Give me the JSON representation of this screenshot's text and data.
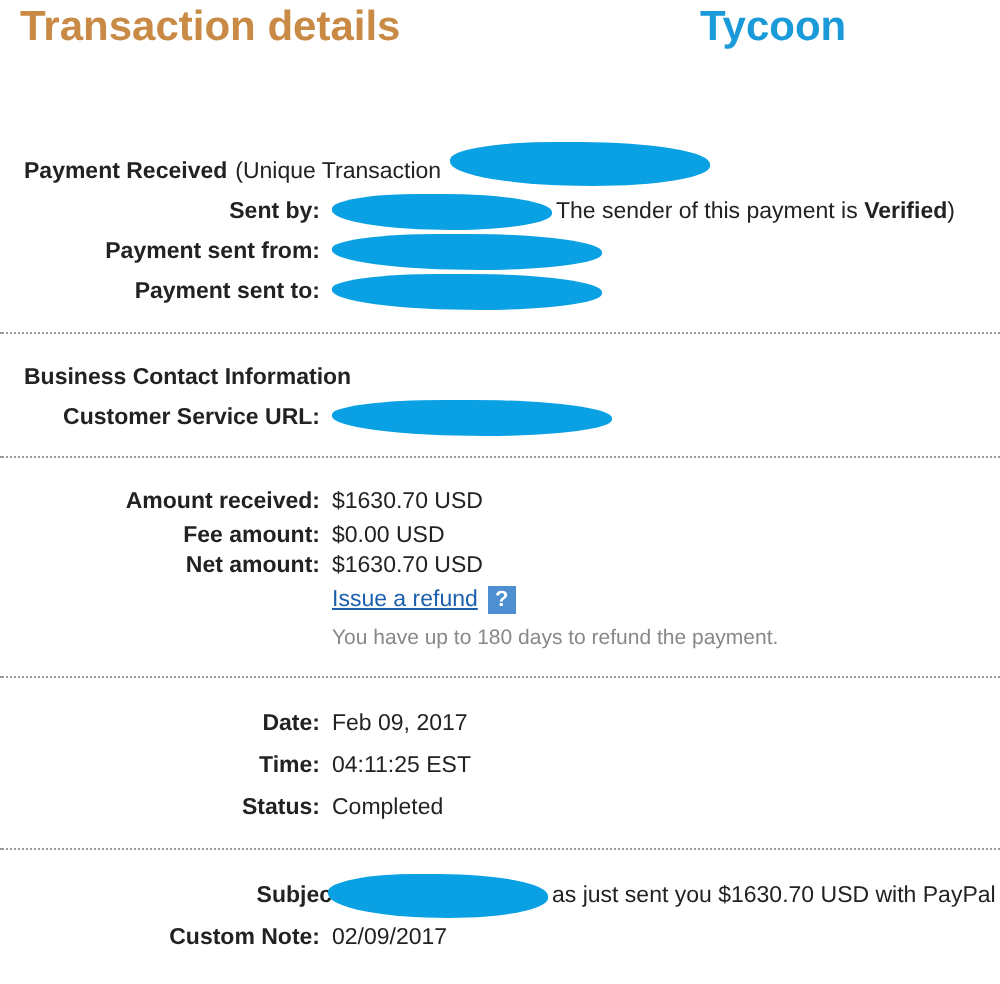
{
  "title": "Transaction details",
  "brand": "Tycoon",
  "payment": {
    "heading": "Payment Received",
    "heading_note": "(Unique Transaction",
    "rows": [
      {
        "label": "Sent by:",
        "after": "The sender of this payment is **Verified**)"
      },
      {
        "label": "Payment sent from:"
      },
      {
        "label": "Payment sent to:"
      }
    ]
  },
  "business": {
    "heading": "Business Contact Information",
    "rows": [
      {
        "label": "Customer Service URL:"
      }
    ]
  },
  "amounts": [
    {
      "label": "Amount received:",
      "value": "$1630.70 USD"
    },
    {
      "label": "Fee amount:",
      "value": "$0.00 USD"
    },
    {
      "label": "Net amount:",
      "value": "$1630.70 USD"
    }
  ],
  "refund": {
    "link": "Issue a refund",
    "help": "?",
    "note": "You have up to 180 days to refund the payment."
  },
  "details": [
    {
      "label": "Date:",
      "value": "Feb 09, 2017"
    },
    {
      "label": "Time:",
      "value": "04:11:25 EST"
    },
    {
      "label": "Status:",
      "value": "Completed"
    }
  ],
  "message": {
    "subject_label": "Subjec",
    "subject_tail": "as just sent you $1630.70 USD with PayPal",
    "note_label": "Custom Note:",
    "note_value": "02/09/2017"
  }
}
